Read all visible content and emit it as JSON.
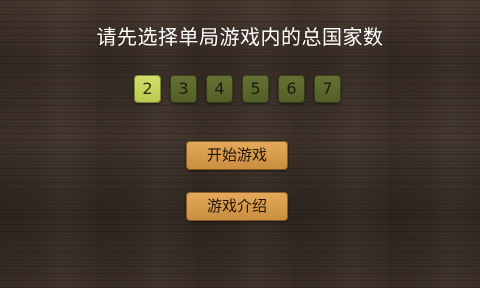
{
  "prompt": "请先选择单局游戏内的总国家数",
  "country_counts": [
    "2",
    "3",
    "4",
    "5",
    "6",
    "7"
  ],
  "selected_count": "2",
  "buttons": {
    "start": "开始游戏",
    "intro": "游戏介绍"
  },
  "colors": {
    "selected_count_bg": "#c8d55a",
    "count_bg": "#5d6a2c",
    "menu_button_bg": "#d89a4a",
    "prompt_text": "#ffffff"
  }
}
